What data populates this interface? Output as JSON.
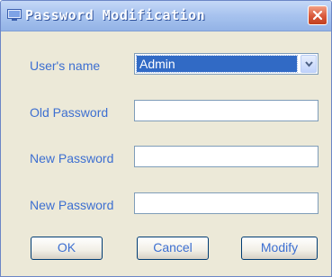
{
  "window": {
    "title": "Password Modification",
    "close_symbol": "×"
  },
  "form": {
    "username": {
      "label": "User's name",
      "value": "Admin"
    },
    "old_password": {
      "label": "Old Password",
      "value": ""
    },
    "new_password": {
      "label": "New Password",
      "value": ""
    },
    "confirm_password": {
      "label": "New Password",
      "value": ""
    }
  },
  "buttons": {
    "ok": "OK",
    "cancel": "Cancel",
    "modify": "Modify"
  },
  "icons": {
    "title": "window-icon",
    "close": "close-icon",
    "dropdown": "chevron-down-icon"
  },
  "colors": {
    "accent_label": "#3d6fd1",
    "selection": "#316ac5",
    "close_button": "#d9583a",
    "dialog_background": "#ece9d8"
  }
}
